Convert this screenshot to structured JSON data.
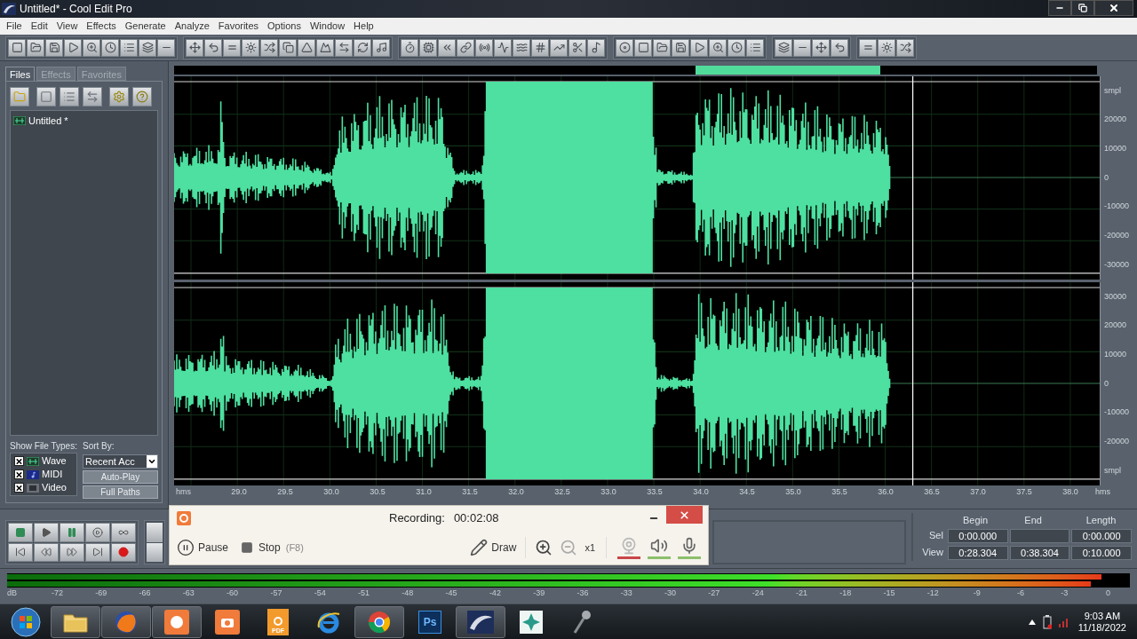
{
  "window": {
    "title": "Untitled* - Cool Edit Pro"
  },
  "menu": [
    "File",
    "Edit",
    "View",
    "Effects",
    "Generate",
    "Analyze",
    "Favorites",
    "Options",
    "Window",
    "Help"
  ],
  "panel": {
    "tabs": [
      {
        "label": "Files",
        "selected": true
      },
      {
        "label": "Effects",
        "selected": false
      },
      {
        "label": "Favorites",
        "selected": false
      }
    ],
    "files": [
      "Untitled *"
    ],
    "show_file_types": {
      "label": "Show File Types:",
      "types": [
        {
          "kind": "wave",
          "label": "Wave",
          "checked": true
        },
        {
          "kind": "midi",
          "label": "MIDI",
          "checked": true
        },
        {
          "kind": "video",
          "label": "Video",
          "checked": true
        }
      ]
    },
    "sort_by": {
      "label": "Sort By:",
      "value": "Recent Acc"
    },
    "buttons": [
      "Auto-Play",
      "Full Paths"
    ]
  },
  "waveform": {
    "time_units": [
      "hms",
      "hms"
    ],
    "time_ticks": [
      "29.0",
      "29.5",
      "30.0",
      "30.5",
      "31.0",
      "31.5",
      "32.0",
      "32.5",
      "33.0",
      "33.5",
      "34.0",
      "34.5",
      "35.0",
      "35.5",
      "36.0",
      "36.5",
      "37.0",
      "37.5",
      "38.0"
    ],
    "channels": [
      {
        "ticks": [
          "smpl",
          "20000",
          "10000",
          "0",
          "-10000",
          "-20000",
          "-30000"
        ]
      },
      {
        "ticks": [
          "30000",
          "20000",
          "10000",
          "0",
          "-10000",
          "-20000",
          "smpl"
        ]
      }
    ]
  },
  "selection": {
    "columns": [
      "Begin",
      "End",
      "Length"
    ],
    "rows": [
      {
        "label": "Sel",
        "begin": "0:00.000",
        "length": "0:00.000"
      },
      {
        "label": "View",
        "begin": "0:28.304",
        "end": "0:38.304",
        "length": "0:10.000"
      }
    ]
  },
  "level_meter": {
    "bars": [
      {
        "level": 0.975
      },
      {
        "level": 0.965
      }
    ],
    "scale": [
      "dB",
      "-72",
      "-69",
      "-66",
      "-63",
      "-60",
      "-57",
      "-54",
      "-51",
      "-48",
      "-45",
      "-42",
      "-39",
      "-36",
      "-33",
      "-30",
      "-27",
      "-24",
      "-21",
      "-18",
      "-15",
      "-12",
      "-9",
      "-6",
      "-3",
      "0"
    ]
  },
  "recorder": {
    "label": "Recording:",
    "time": "00:02:08",
    "pause": "Pause",
    "stop": "Stop",
    "stop_key": "(F8)",
    "draw": "Draw",
    "zoom": "x1",
    "devices": [
      {
        "kind": "webcam",
        "on": false
      },
      {
        "kind": "speaker",
        "on": true
      },
      {
        "kind": "microphone",
        "on": true
      }
    ]
  },
  "taskbar": {
    "apps": [
      {
        "kind": "folder",
        "running": true
      },
      {
        "kind": "globe",
        "running": true
      },
      {
        "kind": "recorder",
        "running": true
      },
      {
        "kind": "camera",
        "running": false
      },
      {
        "kind": "pdf",
        "label": "PDF",
        "running": false
      },
      {
        "kind": "ie",
        "running": false
      },
      {
        "kind": "chrome",
        "running": true
      },
      {
        "kind": "ps",
        "label": "Ps",
        "running": false
      },
      {
        "kind": "wave",
        "running": true
      },
      {
        "kind": "leaf",
        "running": false
      },
      {
        "kind": "mic",
        "running": false
      }
    ],
    "time": "9:03 AM",
    "date": "11/18/2022"
  }
}
